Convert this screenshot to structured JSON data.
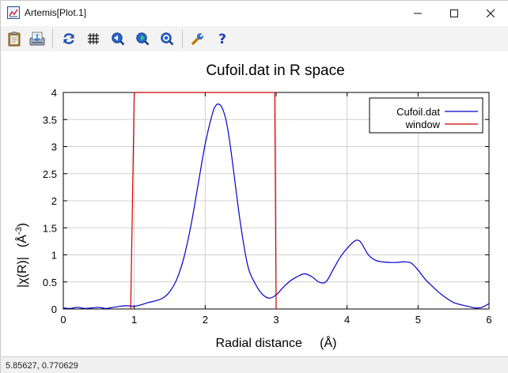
{
  "window": {
    "title": "Artemis[Plot.1]"
  },
  "toolbar": {
    "buttons": [
      {
        "icon": "clipboard-icon",
        "label": "Copy"
      },
      {
        "icon": "save-icon",
        "label": "Save"
      },
      {
        "icon": "refresh-icon",
        "label": "Replot"
      },
      {
        "icon": "grid-icon",
        "label": "Grid"
      },
      {
        "icon": "zoom-back-icon",
        "label": "Previous zoom"
      },
      {
        "icon": "zoom-forward-icon",
        "label": "Next zoom"
      },
      {
        "icon": "zoom-icon",
        "label": "Zoom"
      },
      {
        "icon": "wrench-icon",
        "label": "Settings"
      },
      {
        "icon": "help-icon",
        "label": "Help"
      }
    ]
  },
  "status": {
    "coords": "5.85627,  0.770629"
  },
  "colors": {
    "series_data": "#0000cc",
    "series_window": "#cc0000",
    "grid": "#d0d0d0"
  },
  "chart_data": {
    "type": "line",
    "title": "Cufoil.dat in R space",
    "xlabel": "Radial distance     (Å)",
    "ylabel_main": "|χ(R)|",
    "ylabel_unit": "(Å",
    "ylabel_unit_exp": "-3",
    "ylabel_unit_close": ")",
    "xlim": [
      0,
      6
    ],
    "ylim": [
      0,
      4
    ],
    "xticks": [
      0,
      1,
      2,
      3,
      4,
      5,
      6
    ],
    "yticks": [
      0,
      0.5,
      1,
      1.5,
      2,
      2.5,
      3,
      3.5,
      4
    ],
    "xtick_labels": [
      "0",
      "1",
      "2",
      "3",
      "4",
      "5",
      "6"
    ],
    "ytick_labels": [
      "0",
      "0.5",
      "1",
      "1.5",
      "2",
      "2.5",
      "3",
      "3.5",
      "4"
    ],
    "grid": true,
    "legend_position": "top-right",
    "series": [
      {
        "name": "Cufoil.dat",
        "x": [
          0,
          0.1,
          0.2,
          0.3,
          0.4,
          0.5,
          0.6,
          0.7,
          0.8,
          0.9,
          1.0,
          1.1,
          1.2,
          1.3,
          1.4,
          1.5,
          1.6,
          1.7,
          1.8,
          1.9,
          2.0,
          2.1,
          2.15,
          2.2,
          2.25,
          2.3,
          2.35,
          2.4,
          2.5,
          2.6,
          2.7,
          2.8,
          2.9,
          3.0,
          3.1,
          3.2,
          3.3,
          3.4,
          3.5,
          3.6,
          3.7,
          3.8,
          3.9,
          4.0,
          4.1,
          4.15,
          4.2,
          4.3,
          4.4,
          4.5,
          4.6,
          4.7,
          4.8,
          4.9,
          5.0,
          5.1,
          5.2,
          5.3,
          5.4,
          5.5,
          5.6,
          5.7,
          5.8,
          5.9,
          6.0
        ],
        "y": [
          0.02,
          0.01,
          0.03,
          0.01,
          0.02,
          0.03,
          0.01,
          0.03,
          0.05,
          0.06,
          0.05,
          0.08,
          0.12,
          0.15,
          0.2,
          0.32,
          0.55,
          0.95,
          1.55,
          2.3,
          3.05,
          3.6,
          3.76,
          3.78,
          3.68,
          3.45,
          3.05,
          2.55,
          1.55,
          0.8,
          0.48,
          0.28,
          0.2,
          0.26,
          0.4,
          0.52,
          0.6,
          0.65,
          0.6,
          0.5,
          0.5,
          0.72,
          0.95,
          1.12,
          1.25,
          1.27,
          1.22,
          1.0,
          0.9,
          0.87,
          0.86,
          0.86,
          0.87,
          0.85,
          0.72,
          0.55,
          0.42,
          0.3,
          0.2,
          0.12,
          0.08,
          0.05,
          0.02,
          0.03,
          0.1
        ]
      },
      {
        "name": "window",
        "x": [
          0.95,
          1.0,
          2.98,
          3.0
        ],
        "y": [
          0,
          4,
          4,
          0
        ]
      }
    ]
  }
}
